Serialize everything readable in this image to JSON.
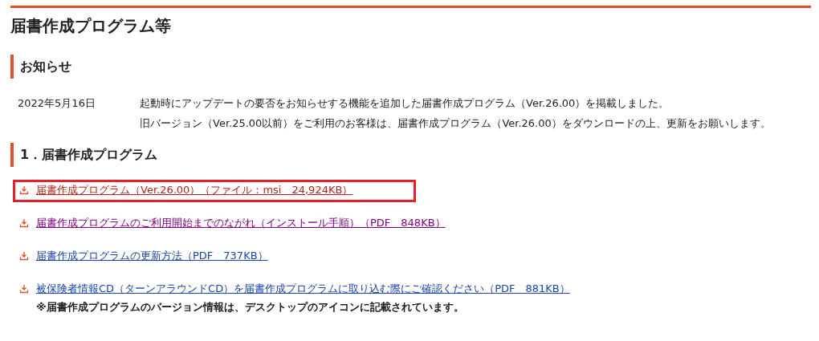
{
  "page_title": "届書作成プログラム等",
  "notice": {
    "heading": "お知らせ",
    "items": [
      {
        "date": "2022年5月16日",
        "paragraphs": [
          "起動時にアップデートの要否をお知らせする機能を追加した届書作成プログラム（Ver.26.00）を掲載しました。",
          "旧バージョン（Ver.25.00以前）をご利用のお客様は、届書作成プログラム（Ver.26.00）をダウンロードの上、更新をお願いします。"
        ]
      }
    ]
  },
  "section": {
    "heading": "1．届書作成プログラム",
    "links": [
      {
        "label": "届書作成プログラム（Ver.26.00）（ファイル：msi　24,924KB）",
        "color": "#b0261c",
        "highlighted": true
      },
      {
        "label": "届書作成プログラムのご利用開始までのながれ（インストール手順）（PDF　848KB）",
        "color": "#800080",
        "highlighted": false
      },
      {
        "label": "届書作成プログラムの更新方法（PDF　737KB）",
        "color": "#1a44a8",
        "highlighted": false
      },
      {
        "label": "被保険者情報CD（ターンアラウンドCD）を届書作成プログラムに取り込む際にご確認ください（PDF　881KB）",
        "color": "#1a44a8",
        "highlighted": false
      }
    ],
    "note": "※届書作成プログラムのバージョン情報は、デスクトップのアイコンに記載されています。"
  }
}
